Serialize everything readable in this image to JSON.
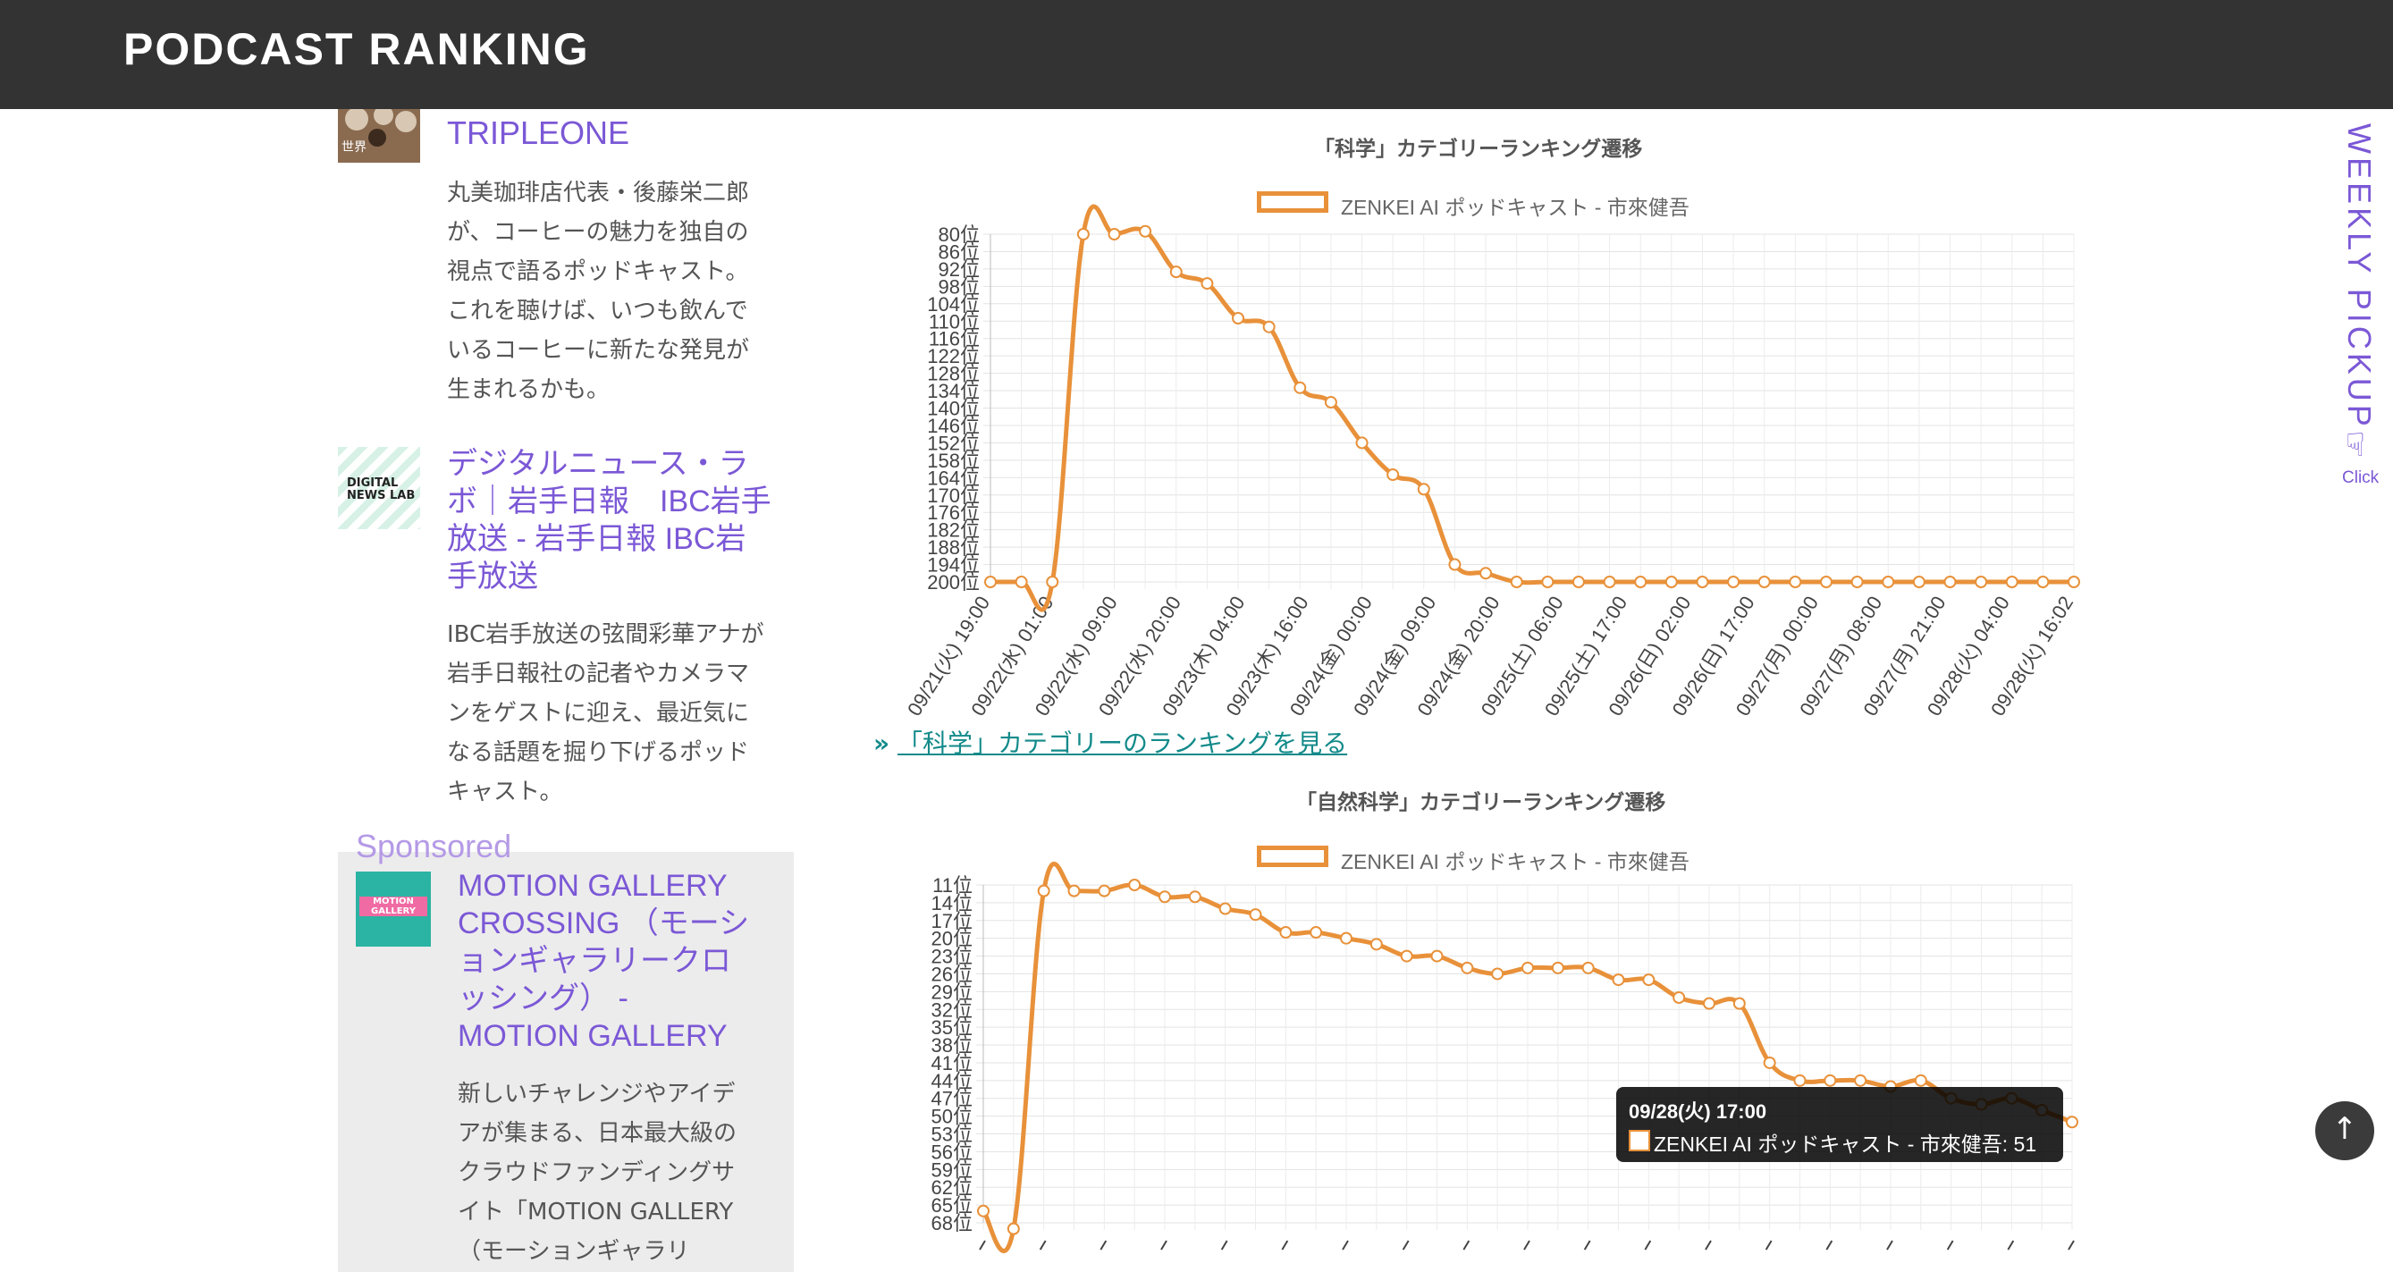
{
  "header": {
    "brand": "PODCAST RANKING"
  },
  "sidebar": {
    "items": [
      {
        "title": "TRIPLEONE",
        "description_lines": [
          "丸美珈琲店代表・後藤栄二郎",
          "が、コーヒーの魅力を独自の",
          "視点で語るポッドキャスト。",
          "これを聴けば、いつも飲んで",
          "いるコーヒーに新たな発見が",
          "生まれるかも。"
        ],
        "thumb_text": "世界"
      },
      {
        "title_lines": [
          "デジタルニュース・ラ",
          "ボ｜岩手日報　IBC岩手",
          "放送 - 岩手日報 IBC岩",
          "手放送"
        ],
        "description_lines": [
          "IBC岩手放送の弦間彩華アナが",
          "岩手日報社の記者やカメラマ",
          "ンをゲストに迎え、最近気に",
          "なる話題を掘り下げるポッド",
          "キャスト。"
        ],
        "thumb_text": "DIGITAL NEWS LAB"
      }
    ],
    "sponsored": {
      "label": "Sponsored",
      "title_lines": [
        "MOTION GALLERY",
        "CROSSING （モーシ",
        "ョンギャラリークロ",
        "ッシング） -",
        "MOTION GALLERY"
      ],
      "description_lines": [
        "新しいチャレンジやアイデ",
        "アが集まる、日本最大級の",
        "クラウドファンディングサ",
        "イト「MOTION GALLERY",
        "（モーションギャラリ"
      ],
      "thumb_text": "MOTION GALLERY"
    }
  },
  "main": {
    "category_link": "「科学」カテゴリーのランキングを見る",
    "tooltip": {
      "title": "09/28(火) 17:00",
      "body": "ZENKEI AI ポッドキャスト - 市來健吾: 51"
    }
  },
  "weekly_pickup": {
    "label": "WEEKLY PICKUP",
    "click": "Click",
    "icon": "pointing-hand-icon"
  },
  "scroll_top": {
    "icon": "arrow-up-icon",
    "label": "↑"
  },
  "colors": {
    "accent": "#7b58d6",
    "line": "#e8913a",
    "topbar": "#333333",
    "link": "#138a8a"
  },
  "chart_data": [
    {
      "type": "line",
      "title": "「科学」カテゴリーランキング遷移",
      "series": [
        {
          "name": "ZENKEI AI ポッドキャスト - 市來健吾",
          "values": [
            200,
            200,
            200,
            80,
            80,
            79,
            93,
            97,
            109,
            112,
            133,
            138,
            152,
            163,
            168,
            194,
            197,
            200,
            200,
            200,
            200,
            200,
            200,
            200,
            200,
            200,
            200,
            200,
            200,
            200,
            200,
            200,
            200,
            200,
            200,
            200
          ]
        }
      ],
      "y_ticks": [
        "80位",
        "86位",
        "92位",
        "98位",
        "104位",
        "110位",
        "116位",
        "122位",
        "128位",
        "134位",
        "140位",
        "146位",
        "152位",
        "158位",
        "164位",
        "170位",
        "176位",
        "182位",
        "188位",
        "194位",
        "200位"
      ],
      "ylim": [
        80,
        200
      ],
      "y_reversed": true,
      "x_tick_labels": [
        "09/21(火) 19:00",
        "09/22(水) 01:00",
        "09/22(水) 09:00",
        "09/22(水) 20:00",
        "09/23(木) 04:00",
        "09/23(木) 16:00",
        "09/24(金) 00:00",
        "09/24(金) 09:00",
        "09/24(金) 20:00",
        "09/25(土) 06:00",
        "09/25(土) 17:00",
        "09/26(日) 02:00",
        "09/26(日) 17:00",
        "09/27(月) 00:00",
        "09/27(月) 08:00",
        "09/27(月) 21:00",
        "09/28(火) 04:00",
        "09/28(火) 16:02"
      ],
      "grid": true,
      "legend": "top"
    },
    {
      "type": "line",
      "title": "「自然科学」カテゴリーランキング遷移",
      "series": [
        {
          "name": "ZENKEI AI ポッドキャスト - 市來健吾",
          "values": [
            66,
            69,
            12,
            12,
            12,
            11,
            13,
            13,
            15,
            16,
            19,
            19,
            20,
            21,
            23,
            23,
            25,
            26,
            25,
            25,
            25,
            27,
            27,
            30,
            31,
            31,
            41,
            44,
            44,
            44,
            45,
            44,
            47,
            48,
            47,
            49,
            51
          ]
        }
      ],
      "y_ticks": [
        "11位",
        "14位",
        "17位",
        "20位",
        "23位",
        "26位",
        "29位",
        "32位",
        "35位",
        "38位",
        "41位",
        "44位",
        "47位",
        "50位",
        "53位",
        "56位",
        "59位",
        "62位",
        "65位",
        "68位"
      ],
      "ylim": [
        11,
        68
      ],
      "y_reversed": true,
      "grid": true,
      "legend": "top"
    }
  ]
}
